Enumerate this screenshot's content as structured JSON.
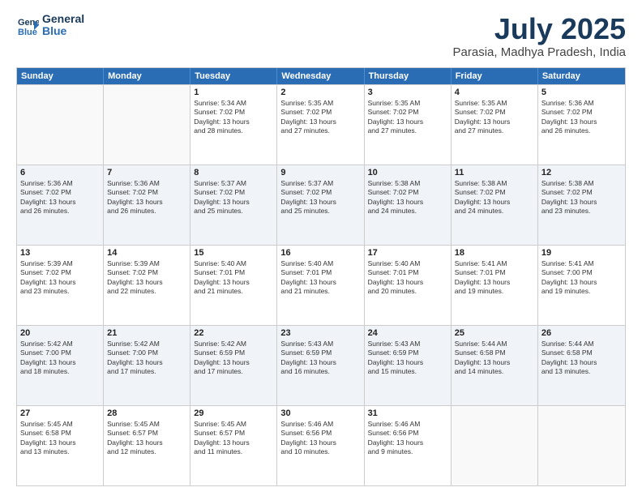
{
  "header": {
    "logo_line1": "General",
    "logo_line2": "Blue",
    "title": "July 2025",
    "location": "Parasia, Madhya Pradesh, India"
  },
  "days_of_week": [
    "Sunday",
    "Monday",
    "Tuesday",
    "Wednesday",
    "Thursday",
    "Friday",
    "Saturday"
  ],
  "weeks": [
    [
      {
        "day": "",
        "info": ""
      },
      {
        "day": "",
        "info": ""
      },
      {
        "day": "1",
        "info": "Sunrise: 5:34 AM\nSunset: 7:02 PM\nDaylight: 13 hours\nand 28 minutes."
      },
      {
        "day": "2",
        "info": "Sunrise: 5:35 AM\nSunset: 7:02 PM\nDaylight: 13 hours\nand 27 minutes."
      },
      {
        "day": "3",
        "info": "Sunrise: 5:35 AM\nSunset: 7:02 PM\nDaylight: 13 hours\nand 27 minutes."
      },
      {
        "day": "4",
        "info": "Sunrise: 5:35 AM\nSunset: 7:02 PM\nDaylight: 13 hours\nand 27 minutes."
      },
      {
        "day": "5",
        "info": "Sunrise: 5:36 AM\nSunset: 7:02 PM\nDaylight: 13 hours\nand 26 minutes."
      }
    ],
    [
      {
        "day": "6",
        "info": "Sunrise: 5:36 AM\nSunset: 7:02 PM\nDaylight: 13 hours\nand 26 minutes."
      },
      {
        "day": "7",
        "info": "Sunrise: 5:36 AM\nSunset: 7:02 PM\nDaylight: 13 hours\nand 26 minutes."
      },
      {
        "day": "8",
        "info": "Sunrise: 5:37 AM\nSunset: 7:02 PM\nDaylight: 13 hours\nand 25 minutes."
      },
      {
        "day": "9",
        "info": "Sunrise: 5:37 AM\nSunset: 7:02 PM\nDaylight: 13 hours\nand 25 minutes."
      },
      {
        "day": "10",
        "info": "Sunrise: 5:38 AM\nSunset: 7:02 PM\nDaylight: 13 hours\nand 24 minutes."
      },
      {
        "day": "11",
        "info": "Sunrise: 5:38 AM\nSunset: 7:02 PM\nDaylight: 13 hours\nand 24 minutes."
      },
      {
        "day": "12",
        "info": "Sunrise: 5:38 AM\nSunset: 7:02 PM\nDaylight: 13 hours\nand 23 minutes."
      }
    ],
    [
      {
        "day": "13",
        "info": "Sunrise: 5:39 AM\nSunset: 7:02 PM\nDaylight: 13 hours\nand 23 minutes."
      },
      {
        "day": "14",
        "info": "Sunrise: 5:39 AM\nSunset: 7:02 PM\nDaylight: 13 hours\nand 22 minutes."
      },
      {
        "day": "15",
        "info": "Sunrise: 5:40 AM\nSunset: 7:01 PM\nDaylight: 13 hours\nand 21 minutes."
      },
      {
        "day": "16",
        "info": "Sunrise: 5:40 AM\nSunset: 7:01 PM\nDaylight: 13 hours\nand 21 minutes."
      },
      {
        "day": "17",
        "info": "Sunrise: 5:40 AM\nSunset: 7:01 PM\nDaylight: 13 hours\nand 20 minutes."
      },
      {
        "day": "18",
        "info": "Sunrise: 5:41 AM\nSunset: 7:01 PM\nDaylight: 13 hours\nand 19 minutes."
      },
      {
        "day": "19",
        "info": "Sunrise: 5:41 AM\nSunset: 7:00 PM\nDaylight: 13 hours\nand 19 minutes."
      }
    ],
    [
      {
        "day": "20",
        "info": "Sunrise: 5:42 AM\nSunset: 7:00 PM\nDaylight: 13 hours\nand 18 minutes."
      },
      {
        "day": "21",
        "info": "Sunrise: 5:42 AM\nSunset: 7:00 PM\nDaylight: 13 hours\nand 17 minutes."
      },
      {
        "day": "22",
        "info": "Sunrise: 5:42 AM\nSunset: 6:59 PM\nDaylight: 13 hours\nand 17 minutes."
      },
      {
        "day": "23",
        "info": "Sunrise: 5:43 AM\nSunset: 6:59 PM\nDaylight: 13 hours\nand 16 minutes."
      },
      {
        "day": "24",
        "info": "Sunrise: 5:43 AM\nSunset: 6:59 PM\nDaylight: 13 hours\nand 15 minutes."
      },
      {
        "day": "25",
        "info": "Sunrise: 5:44 AM\nSunset: 6:58 PM\nDaylight: 13 hours\nand 14 minutes."
      },
      {
        "day": "26",
        "info": "Sunrise: 5:44 AM\nSunset: 6:58 PM\nDaylight: 13 hours\nand 13 minutes."
      }
    ],
    [
      {
        "day": "27",
        "info": "Sunrise: 5:45 AM\nSunset: 6:58 PM\nDaylight: 13 hours\nand 13 minutes."
      },
      {
        "day": "28",
        "info": "Sunrise: 5:45 AM\nSunset: 6:57 PM\nDaylight: 13 hours\nand 12 minutes."
      },
      {
        "day": "29",
        "info": "Sunrise: 5:45 AM\nSunset: 6:57 PM\nDaylight: 13 hours\nand 11 minutes."
      },
      {
        "day": "30",
        "info": "Sunrise: 5:46 AM\nSunset: 6:56 PM\nDaylight: 13 hours\nand 10 minutes."
      },
      {
        "day": "31",
        "info": "Sunrise: 5:46 AM\nSunset: 6:56 PM\nDaylight: 13 hours\nand 9 minutes."
      },
      {
        "day": "",
        "info": ""
      },
      {
        "day": "",
        "info": ""
      }
    ]
  ]
}
